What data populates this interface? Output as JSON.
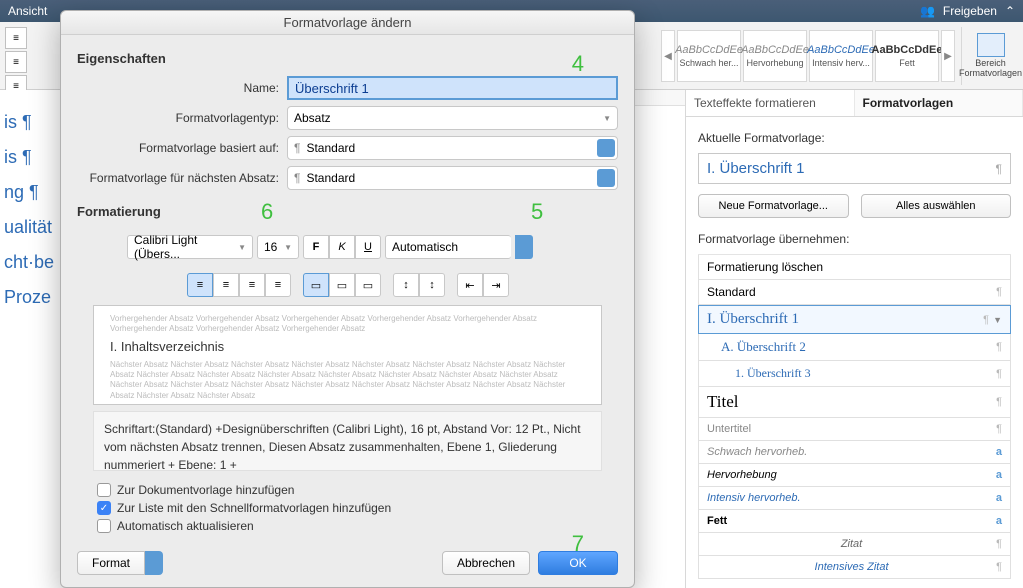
{
  "topbar": {
    "view": "Ansicht",
    "share": "Freigeben"
  },
  "styleGallery": [
    {
      "preview": "AaBbCcDdEe",
      "label": "Schwach her...",
      "cls": "emph-weak"
    },
    {
      "preview": "AaBbCcDdEe",
      "label": "Hervorhebung",
      "cls": "emph"
    },
    {
      "preview": "AaBbCcDdEe",
      "label": "Intensiv herv...",
      "cls": "emph-int"
    },
    {
      "preview": "AaBbCcDdEe",
      "label": "Fett",
      "cls": "bold"
    }
  ],
  "paneToggle": "Bereich Formatvorlagen",
  "dialog": {
    "title": "Formatvorlage ändern",
    "propsHeader": "Eigenschaften",
    "rows": {
      "nameLabel": "Name:",
      "nameValue": "Überschrift 1",
      "typeLabel": "Formatvorlagentyp:",
      "typeValue": "Absatz",
      "basedLabel": "Formatvorlage basiert auf:",
      "basedValue": "Standard",
      "nextLabel": "Formatvorlage für nächsten Absatz:",
      "nextValue": "Standard"
    },
    "formatHeader": "Formatierung",
    "font": "Calibri Light (Übers...",
    "fontSize": "16",
    "colorCombo": "Automatisch",
    "previewFill": "Vorhergehender Absatz Vorhergehender Absatz Vorhergehender Absatz Vorhergehender Absatz Vorhergehender Absatz Vorhergehender Absatz Vorhergehender Absatz Vorhergehender Absatz",
    "previewSample": "I.      Inhaltsverzeichnis",
    "previewFillAfter": "Nächster Absatz Nächster Absatz Nächster Absatz Nächster Absatz Nächster Absatz Nächster Absatz Nächster Absatz Nächster Absatz Nächster Absatz Nächster Absatz Nächster Absatz Nächster Absatz Nächster Absatz Nächster Absatz Nächster Absatz Nächster Absatz Nächster Absatz Nächster Absatz Nächster Absatz Nächster Absatz Nächster Absatz Nächster Absatz Nächster Absatz Nächster Absatz Nächster Absatz",
    "desc": "Schriftart:(Standard) +Designüberschriften (Calibri Light), 16 pt, Abstand Vor:  12  Pt., Nicht vom nächsten Absatz trennen, Diesen Absatz zusammenhalten, Ebene 1, Gliederung nummeriert + Ebene: 1 +",
    "check1": "Zur Dokumentvorlage hinzufügen",
    "check2": "Zur Liste mit den Schnellformatvorlagen hinzufügen",
    "check3": "Automatisch aktualisieren",
    "formatBtn": "Format",
    "cancel": "Abbrechen",
    "ok": "OK"
  },
  "rightPane": {
    "tab1": "Texteffekte formatieren",
    "tab2": "Formatvorlagen",
    "currentLabel": "Aktuelle Formatvorlage:",
    "currentStyle": "I.  Überschrift 1",
    "newBtn": "Neue Formatvorlage...",
    "selectAllBtn": "Alles auswählen",
    "applyLabel": "Formatvorlage übernehmen:",
    "list": [
      {
        "name": "Formatierung löschen",
        "mark": "",
        "cls": ""
      },
      {
        "name": "Standard",
        "mark": "¶",
        "cls": ""
      },
      {
        "name": "I.  Überschrift 1",
        "mark": "¶",
        "cls": "h1",
        "selected": true,
        "dd": true
      },
      {
        "name": "A.  Überschrift 2",
        "mark": "¶",
        "cls": "h2"
      },
      {
        "name": "1.  Überschrift 3",
        "mark": "¶",
        "cls": "h3"
      },
      {
        "name": "Titel",
        "mark": "¶",
        "cls": "title"
      },
      {
        "name": "Untertitel",
        "mark": "¶",
        "cls": "subtitle"
      },
      {
        "name": "Schwach hervorheb.",
        "mark": "a",
        "cls": "emph-weak"
      },
      {
        "name": "Hervorhebung",
        "mark": "a",
        "cls": "emph"
      },
      {
        "name": "Intensiv hervorheb.",
        "mark": "a",
        "cls": "emph-int"
      },
      {
        "name": "Fett",
        "mark": "a",
        "cls": "bold"
      },
      {
        "name": "Zitat",
        "mark": "¶",
        "cls": "quote"
      },
      {
        "name": "Intensives Zitat",
        "mark": "¶",
        "cls": "quote-int"
      }
    ]
  },
  "docFragments": [
    "is ¶",
    "is ¶",
    "",
    "ng ¶",
    "ualität",
    "",
    "cht·be",
    "Proze"
  ],
  "annotations": {
    "a4": "4",
    "a5": "5",
    "a6": "6",
    "a7": "7"
  }
}
